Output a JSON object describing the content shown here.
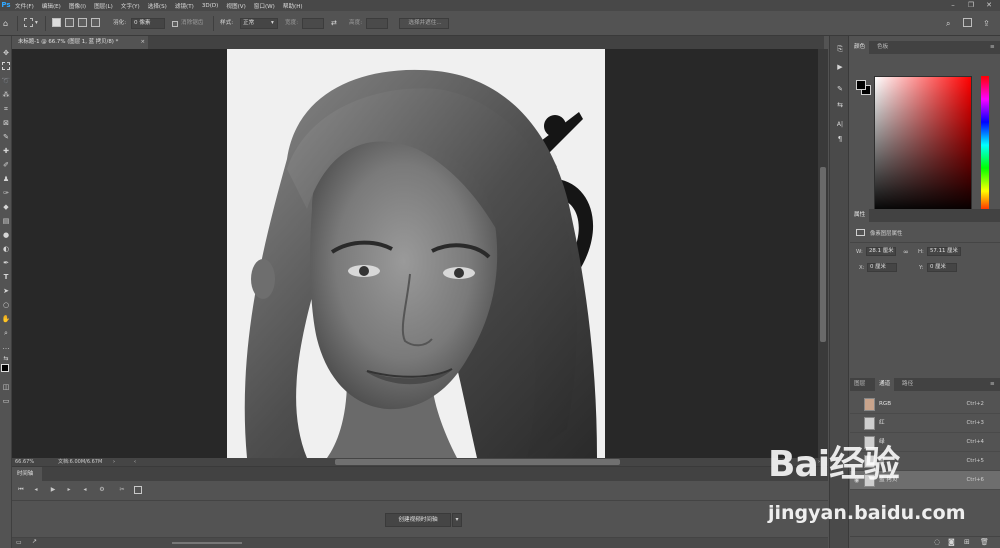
{
  "app": {
    "logo": "Ps"
  },
  "menu": [
    "文件(F)",
    "编辑(E)",
    "图像(I)",
    "图层(L)",
    "文字(Y)",
    "选择(S)",
    "滤镜(T)",
    "3D(D)",
    "视图(V)",
    "窗口(W)",
    "帮助(H)"
  ],
  "options": {
    "feather_label": "羽化:",
    "feather_value": "0 像素",
    "antialias_label": "消除锯齿",
    "style_label": "样式:",
    "style_value": "正常",
    "width_label": "宽度:",
    "height_label": "高度:",
    "select_mask_button": "选择并遮住..."
  },
  "document": {
    "tab_title": "未标题-1 @ 66.7% (图层 1, 蓝 拷贝/8) *",
    "close": "×"
  },
  "status": {
    "zoom": "66.67%",
    "doc_info": "文档:6.00M/6.67M"
  },
  "timeline": {
    "tab": "时间轴",
    "create_button": "创建视频时间轴"
  },
  "panels": {
    "color_tabs": [
      "颜色",
      "色板"
    ],
    "properties_tab": "属性",
    "properties_title": "像素图层属性",
    "w_label": "W:",
    "w_value": "28.1 厘米",
    "h_label": "H:",
    "h_value": "57.11 厘米",
    "x_label": "X:",
    "x_value": "0 厘米",
    "y_label": "Y:",
    "y_value": "0 厘米",
    "layer_tabs": [
      "图层",
      "通道",
      "路径"
    ],
    "channels": [
      {
        "name": "RGB",
        "key": "Ctrl+2"
      },
      {
        "name": "红",
        "key": "Ctrl+3"
      },
      {
        "name": "绿",
        "key": "Ctrl+4"
      },
      {
        "name": "蓝",
        "key": "Ctrl+5"
      },
      {
        "name": "蓝 拷贝",
        "key": "Ctrl+6"
      }
    ]
  },
  "watermark": {
    "brand": "Bai经验",
    "url": "jingyan.baidu.com"
  }
}
